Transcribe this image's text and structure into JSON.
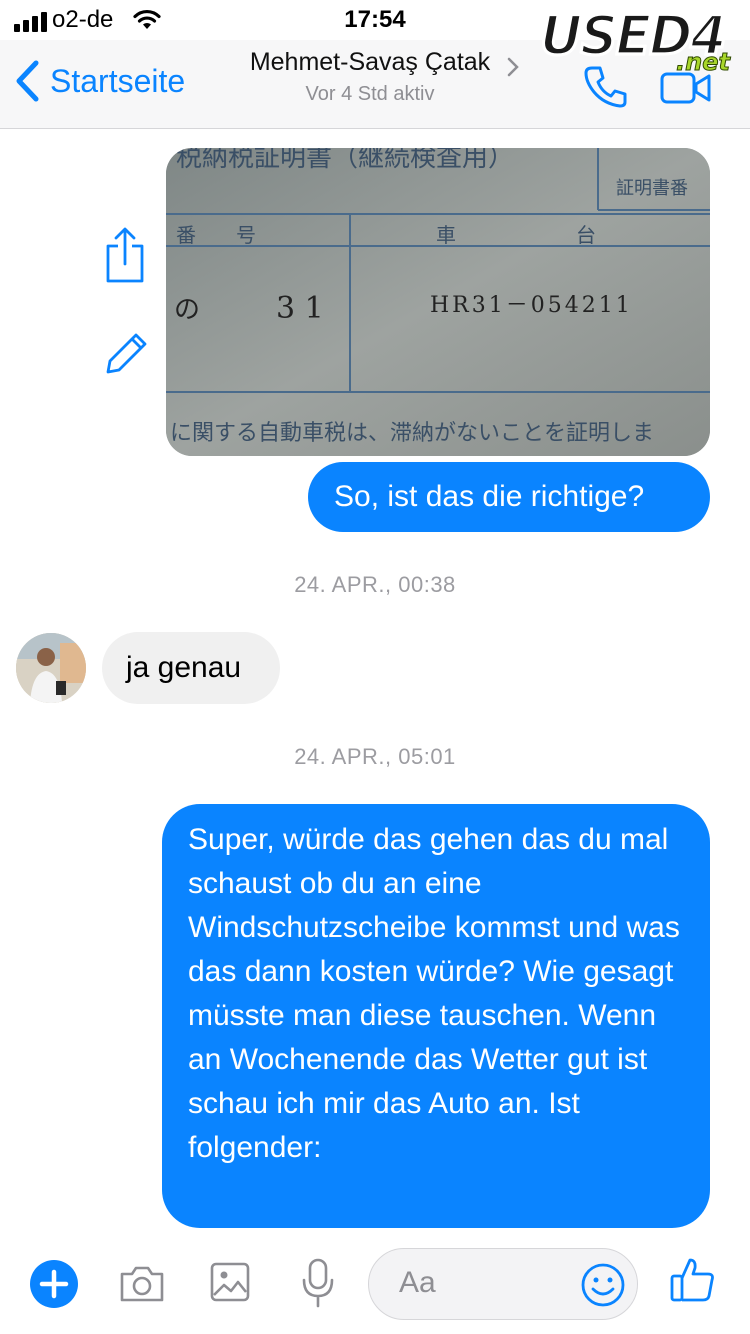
{
  "status_bar": {
    "carrier": "o2-de",
    "time": "17:54"
  },
  "nav": {
    "back_label": "Startseite",
    "contact_name": "Mehmet-Savaş Çatak",
    "contact_status": "Vor 4 Std aktiv"
  },
  "watermark": {
    "logo_text": "USED4",
    "logo_suffix": ".net"
  },
  "messages": [
    {
      "type": "image",
      "direction": "outgoing",
      "image_text": {
        "title": "税納税証明書（継続検査用）",
        "stamp": "証明書番",
        "col_left": "番　　号",
        "col_right": "車　　　　　　台",
        "row_kana": "の",
        "row_number": "3 1",
        "chassis": "HR31－054211",
        "footer": "に関する自動車税は、滞納がないことを証明しま"
      }
    },
    {
      "type": "text",
      "direction": "outgoing",
      "text": "So, ist das die richtige?"
    },
    {
      "type": "timestamp",
      "text": "24. APR., 00:38"
    },
    {
      "type": "text",
      "direction": "incoming",
      "text": "ja genau"
    },
    {
      "type": "timestamp",
      "text": "24. APR., 05:01"
    },
    {
      "type": "text",
      "direction": "outgoing",
      "text": "Super, würde das gehen das du mal schaust ob du an eine Windschutzscheibe kommst und was das dann kosten würde? Wie gesagt müsste man diese tauschen. Wenn an Wochenende das Wetter gut ist schau ich mir das Auto an. Ist folgender:"
    }
  ],
  "composer": {
    "placeholder": "Aa"
  },
  "colors": {
    "accent": "#0a84ff",
    "incoming_bubble": "#f0f0f0",
    "timestamp": "#9c9ca1"
  },
  "icons": [
    "signal-icon",
    "wifi-icon",
    "back-chevron-icon",
    "chevron-right-icon",
    "phone-icon",
    "video-icon",
    "share-icon",
    "edit-icon",
    "plus-icon",
    "camera-icon",
    "image-icon",
    "microphone-icon",
    "smiley-icon",
    "thumbs-up-icon"
  ]
}
